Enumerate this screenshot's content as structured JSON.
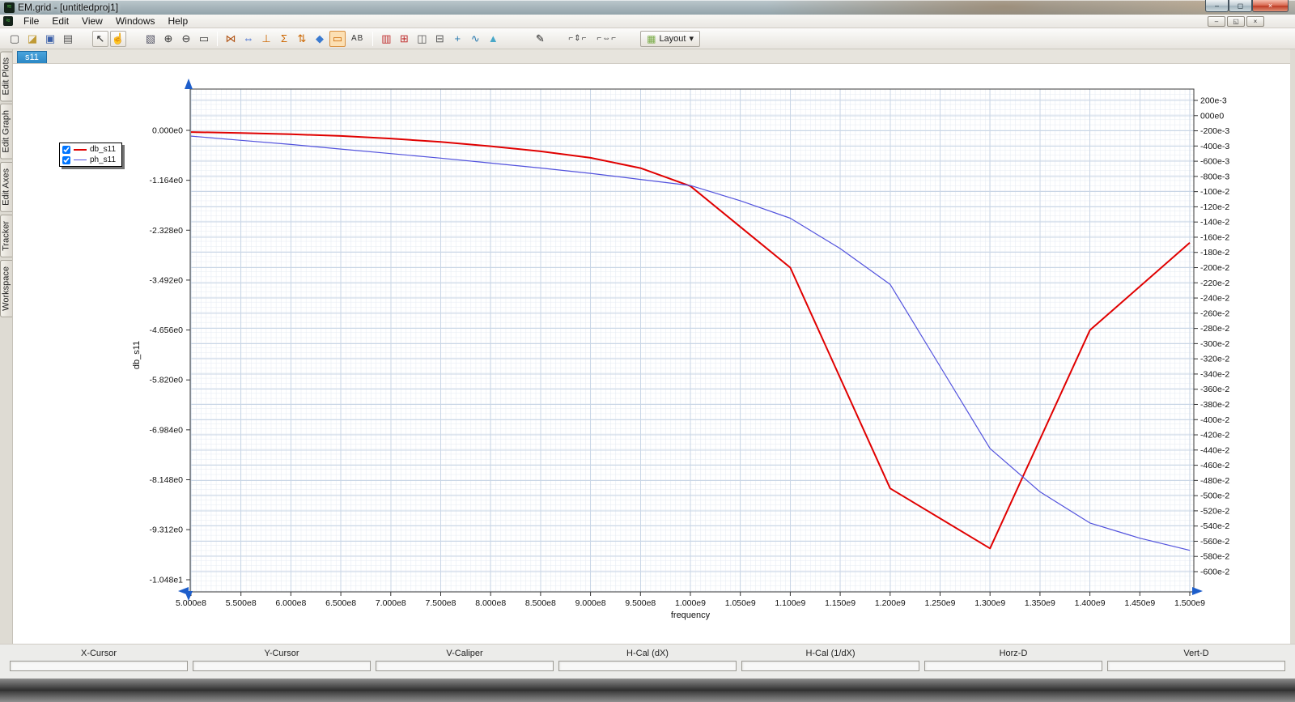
{
  "window": {
    "title": "EM.grid - [untitledproj1]",
    "buttons": [
      {
        "name": "minimize-button",
        "glyph": "–"
      },
      {
        "name": "maximize-button",
        "glyph": "◻"
      },
      {
        "name": "close-button",
        "glyph": "×"
      }
    ]
  },
  "menu": {
    "items": [
      "File",
      "Edit",
      "View",
      "Windows",
      "Help"
    ]
  },
  "doc_window_buttons": [
    {
      "name": "minimize-doc-button",
      "glyph": "–"
    },
    {
      "name": "restore-doc-button",
      "glyph": "◱"
    },
    {
      "name": "close-doc-button",
      "glyph": "×"
    }
  ],
  "toolbar": {
    "layout_label": "Layout",
    "layout_icon": "▦",
    "layout_arrow": "▾",
    "items": [
      {
        "name": "new-file",
        "glyph": "▢",
        "color": "#555555"
      },
      {
        "name": "open-file",
        "glyph": "◪",
        "color": "#c09a35"
      },
      {
        "name": "save-file",
        "glyph": "▣",
        "color": "#3a5fa8"
      },
      {
        "name": "print",
        "glyph": "▤",
        "color": "#555555"
      },
      {
        "type": "gap"
      },
      {
        "name": "select-tool",
        "glyph": "↖",
        "color": "#222222",
        "framed": true
      },
      {
        "name": "pan-tool",
        "glyph": "☝",
        "color": "#a87830",
        "framed": true
      },
      {
        "type": "gap"
      },
      {
        "name": "zoom-window-tool",
        "glyph": "▧",
        "color": "#556"
      },
      {
        "name": "zoom-in-tool",
        "glyph": "⊕",
        "color": "#333333"
      },
      {
        "name": "zoom-out-tool",
        "glyph": "⊖",
        "color": "#333333"
      },
      {
        "name": "zoom-fit-tool",
        "glyph": "▭",
        "color": "#333333"
      },
      {
        "type": "sep"
      },
      {
        "name": "previous-view-tool",
        "glyph": "⋈",
        "color": "#b05010"
      },
      {
        "name": "swap-axes-tool",
        "glyph": "⇔",
        "color": "#2255cc"
      },
      {
        "name": "vertical-axis-tool",
        "glyph": "⊥",
        "color": "#cc6600"
      },
      {
        "name": "autoscale-tool",
        "glyph": "Σ",
        "color": "#cc6600"
      },
      {
        "name": "fit-vertical-tool",
        "glyph": "⇅",
        "color": "#cc6600"
      },
      {
        "name": "marker-diamond-tool",
        "glyph": "◆",
        "color": "#3a7ad0"
      },
      {
        "name": "zoom-box-tool",
        "glyph": "▭",
        "color": "#cc6600",
        "active": true
      },
      {
        "name": "label-tool",
        "glyph": "AB",
        "color": "#333333",
        "wide": true
      },
      {
        "type": "sep"
      },
      {
        "name": "bar-plot-tool",
        "glyph": "▥",
        "color": "#c03030"
      },
      {
        "name": "grid-plot-tool",
        "glyph": "⊞",
        "color": "#c03030"
      },
      {
        "name": "two-pane-tool",
        "glyph": "◫",
        "color": "#555555"
      },
      {
        "name": "split-pane-tool",
        "glyph": "⊟",
        "color": "#555555"
      },
      {
        "name": "add-plot-tool",
        "glyph": "+",
        "color": "#2a7ab0"
      },
      {
        "name": "smooth-curve-tool",
        "glyph": "∿",
        "color": "#2a7ab0"
      },
      {
        "name": "area-plot-tool",
        "glyph": "▲",
        "color": "#49a8c8"
      },
      {
        "type": "gap"
      },
      {
        "type": "gap"
      },
      {
        "name": "pencil-tool",
        "glyph": "✎",
        "color": "#222222"
      },
      {
        "type": "gap"
      },
      {
        "name": "y-cursor-tool",
        "glyph": "⌐⇕⌐",
        "color": "#333333",
        "wide": true
      },
      {
        "name": "x-cursor-tool",
        "glyph": "⌐⇔⌐",
        "color": "#333333",
        "wide": true
      },
      {
        "type": "gap"
      }
    ]
  },
  "side_tabs": [
    "Edit Plots",
    "Edit Graph",
    "Edit Axes",
    "Tracker",
    "Workspace"
  ],
  "doc_tabs": [
    "s11"
  ],
  "legend": [
    {
      "label": "db_s11",
      "color": "#e00000",
      "width": 2,
      "checked": true
    },
    {
      "label": "ph_s11",
      "color": "#5252dd",
      "width": 1,
      "checked": true
    }
  ],
  "status_fields": [
    "X-Cursor",
    "Y-Cursor",
    "V-Caliper",
    "H-Cal (dX)",
    "H-Cal (1/dX)",
    "Horz-D",
    "Vert-D"
  ],
  "chart_data": {
    "type": "line",
    "title": "",
    "xlabel": "frequency",
    "ylabel_left": "db_s11",
    "grid": true,
    "legend_position": "top-left",
    "x_ticks": {
      "values": [
        500000000.0,
        550000000.0,
        600000000.0,
        650000000.0,
        700000000.0,
        750000000.0,
        800000000.0,
        850000000.0,
        900000000.0,
        950000000.0,
        1000000000.0,
        1050000000.0,
        1100000000.0,
        1150000000.0,
        1200000000.0,
        1250000000.0,
        1300000000.0,
        1350000000.0,
        1400000000.0,
        1450000000.0,
        1500000000.0
      ],
      "labels": [
        "5.000e8",
        "5.500e8",
        "6.000e8",
        "6.500e8",
        "7.000e8",
        "7.500e8",
        "8.000e8",
        "8.500e8",
        "9.000e8",
        "9.500e8",
        "1.000e9",
        "1.050e9",
        "1.100e9",
        "1.150e9",
        "1.200e9",
        "1.250e9",
        "1.300e9",
        "1.350e9",
        "1.400e9",
        "1.450e9",
        "1.500e9"
      ]
    },
    "left_axis": {
      "tick_values": [
        0,
        -1.164,
        -2.328,
        -3.492,
        -4.656,
        -5.82,
        -6.984,
        -8.148,
        -9.312,
        -10.48
      ],
      "tick_labels": [
        "0.000e0",
        "-1.164e0",
        "-2.328e0",
        "-3.492e0",
        "-4.656e0",
        "-5.820e0",
        "-6.984e0",
        "-8.148e0",
        "-9.312e0",
        "-1.048e1"
      ]
    },
    "right_axis": {
      "tick_start": 0.2,
      "tick_step": -0.2,
      "tick_labels": [
        "200e-3",
        "000e0",
        "-200e-3",
        "-400e-3",
        "-600e-3",
        "-800e-3",
        "-100e-2",
        "-120e-2",
        "-140e-2",
        "-160e-2",
        "-180e-2",
        "-200e-2",
        "-220e-2",
        "-240e-2",
        "-260e-2",
        "-280e-2",
        "-300e-2",
        "-320e-2",
        "-340e-2",
        "-360e-2",
        "-380e-2",
        "-400e-2",
        "-420e-2",
        "-440e-2",
        "-460e-2",
        "-480e-2",
        "-500e-2",
        "-520e-2",
        "-540e-2",
        "-560e-2",
        "-580e-2",
        "-600e-2"
      ]
    },
    "series": [
      {
        "name": "db_s11",
        "axis": "left",
        "color": "#e00000",
        "width": 2,
        "x": [
          500000000.0,
          550000000.0,
          600000000.0,
          650000000.0,
          700000000.0,
          750000000.0,
          800000000.0,
          850000000.0,
          900000000.0,
          950000000.0,
          1000000000.0,
          1050000000.0,
          1100000000.0,
          1200000000.0,
          1300000000.0,
          1400000000.0,
          1500000000.0
        ],
        "y": [
          -0.04,
          -0.06,
          -0.09,
          -0.13,
          -0.19,
          -0.27,
          -0.37,
          -0.49,
          -0.64,
          -0.88,
          -1.3,
          -2.25,
          -3.2,
          -8.35,
          -9.75,
          -4.66,
          -2.62
        ]
      },
      {
        "name": "ph_s11",
        "axis": "right",
        "color": "#5252dd",
        "width": 1.2,
        "x": [
          500000000.0,
          550000000.0,
          600000000.0,
          650000000.0,
          700000000.0,
          750000000.0,
          800000000.0,
          850000000.0,
          900000000.0,
          950000000.0,
          1000000000.0,
          1050000000.0,
          1100000000.0,
          1150000000.0,
          1200000000.0,
          1250000000.0,
          1300000000.0,
          1350000000.0,
          1400000000.0,
          1450000000.0,
          1500000000.0
        ],
        "y": [
          -0.27,
          -0.325,
          -0.38,
          -0.44,
          -0.5,
          -0.56,
          -0.625,
          -0.69,
          -0.76,
          -0.84,
          -0.92,
          -1.12,
          -1.35,
          -1.75,
          -2.22,
          -3.3,
          -4.38,
          -4.95,
          -5.36,
          -5.56,
          -5.72
        ]
      }
    ]
  }
}
